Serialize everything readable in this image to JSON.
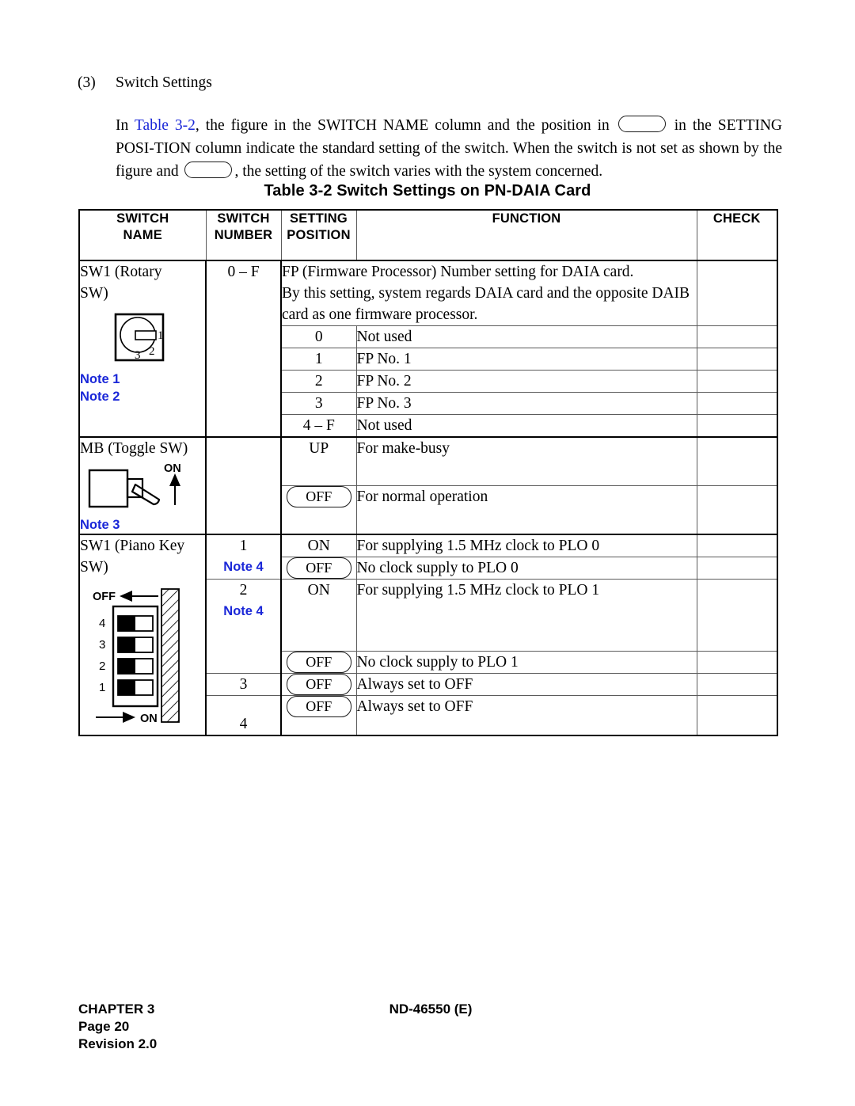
{
  "section": {
    "number": "(3)",
    "heading": "Switch Settings",
    "paragraph_parts": {
      "p1": "In ",
      "link": "Table 3-2",
      "p2": ", the figure in the SWITCH NAME column and the position in ",
      "p3": " in the SETTING POSI-TION column indicate the standard setting of the switch. When the switch is not set as shown by the figure and ",
      "p4": ", the setting of the switch varies with the system concerned."
    }
  },
  "table": {
    "title": "Table 3-2  Switch Settings on PN-DAIA Card",
    "headers": {
      "switch_name": "SWITCH\nNAME",
      "switch_name_l1": "SWITCH",
      "switch_name_l2": "NAME",
      "switch_number_l1": "SWITCH",
      "switch_number_l2": "NUMBER",
      "setting_position_l1": "SETTING",
      "setting_position_l2": "POSITION",
      "function": "FUNCTION",
      "check": "CHECK"
    },
    "sections": [
      {
        "id": "rotary",
        "name_line1": "SW1 (Rotary",
        "name_line2": "SW)",
        "icon": "rotary-switch-icon",
        "icon_labels": [
          "1",
          "2",
          "3"
        ],
        "notes": [
          "Note 1",
          "Note 2"
        ],
        "switch_number": "0 – F",
        "intro_function": [
          "FP (Firmware Processor) Number setting for DAIA card.",
          "By this setting, system regards DAIA card and the opposite DAIB",
          "card as one firmware processor."
        ],
        "rows": [
          {
            "position": "0",
            "pill": false,
            "function": "Not used",
            "check": ""
          },
          {
            "position": "1",
            "pill": false,
            "function": "FP No. 1",
            "check": ""
          },
          {
            "position": "2",
            "pill": false,
            "function": "FP No. 2",
            "check": ""
          },
          {
            "position": "3",
            "pill": false,
            "function": "FP No. 3",
            "check": ""
          },
          {
            "position": "4 – F",
            "pill": false,
            "function": "Not used",
            "check": ""
          }
        ]
      },
      {
        "id": "toggle",
        "name_line1": "MB (Toggle SW)",
        "name_line2": "",
        "icon": "toggle-switch-icon",
        "icon_labels": [
          "ON"
        ],
        "notes": [
          "Note 3"
        ],
        "switch_number": "",
        "intro_function": [],
        "rows": [
          {
            "position": "UP",
            "pill": false,
            "function": "For make-busy",
            "check": ""
          },
          {
            "position": "OFF",
            "pill": true,
            "function": "For normal operation",
            "check": ""
          }
        ]
      },
      {
        "id": "piano",
        "name_line1": "SW1 (Piano Key",
        "name_line2": "SW)",
        "icon": "piano-key-switch-icon",
        "icon_labels": [
          "OFF",
          "4",
          "3",
          "2",
          "1",
          "ON"
        ],
        "notes": [],
        "switch_number": "",
        "intro_function": [],
        "rows": [
          {
            "number": "1",
            "number_note": "Note 4",
            "position": "ON",
            "pill": false,
            "function": "For supplying 1.5 MHz clock to PLO 0",
            "check": ""
          },
          {
            "number": "",
            "number_note": "",
            "position": "OFF",
            "pill": true,
            "function": "No clock supply to PLO 0",
            "check": ""
          },
          {
            "number": "2",
            "number_note": "Note 4",
            "position": "ON",
            "pill": false,
            "function": "For supplying 1.5 MHz clock to PLO 1",
            "check": ""
          },
          {
            "number": "",
            "number_note": "",
            "position": "OFF",
            "pill": true,
            "function": "No clock supply to PLO 1",
            "check": ""
          },
          {
            "number": "3",
            "number_note": "",
            "position": "OFF",
            "pill": true,
            "function": "Always set to OFF",
            "check": ""
          },
          {
            "number": "4",
            "number_note": "",
            "position": "OFF",
            "pill": true,
            "function": "Always set to OFF",
            "check": ""
          }
        ]
      }
    ]
  },
  "footer": {
    "chapter": "CHAPTER  3",
    "page": "Page  20",
    "revision": "Revision  2.0",
    "doc_id": "ND-46550 (E)"
  },
  "colors": {
    "link_blue": "#1a27d8",
    "note_blue": "#1a27d8",
    "rule": "#5b5b5b",
    "frame": "#000000"
  }
}
